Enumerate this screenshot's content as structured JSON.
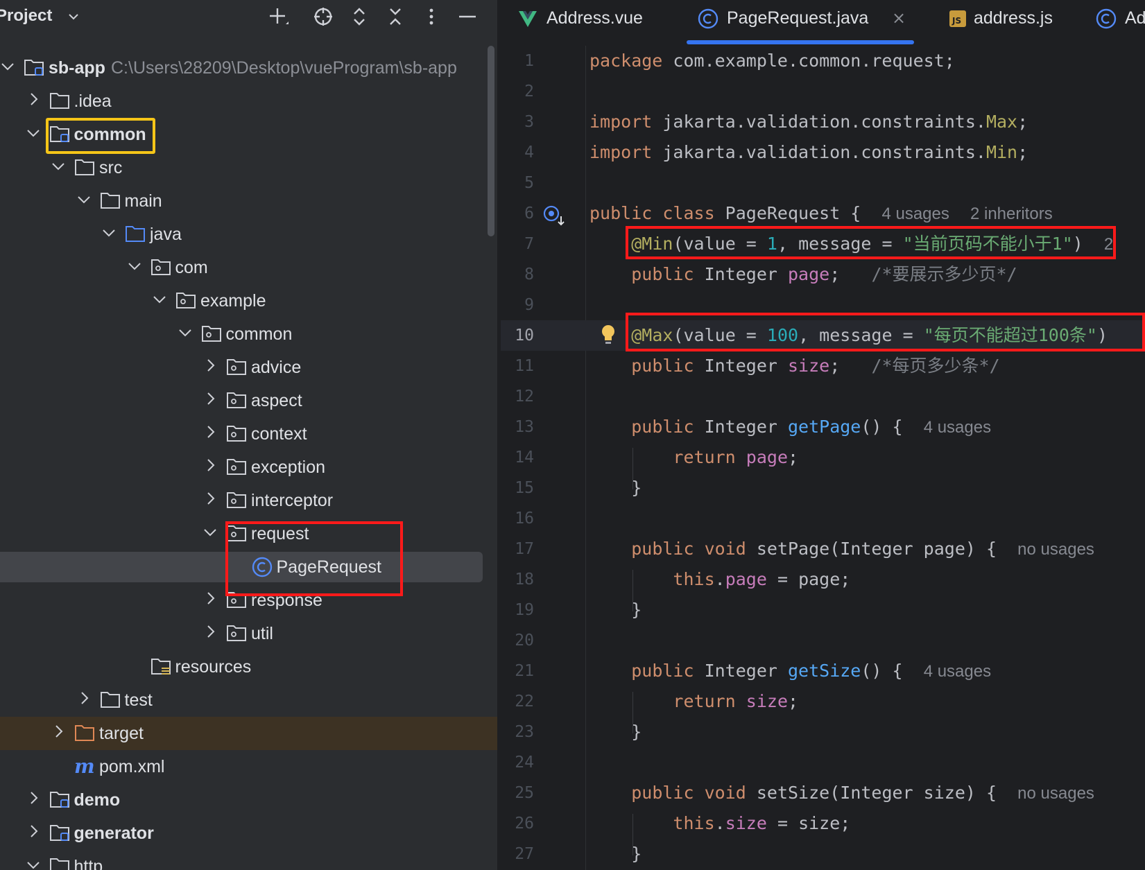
{
  "panel": {
    "title": "Project",
    "title_chevron": "chevron-down-icon",
    "header_icons": [
      "add-icon",
      "locate-icon",
      "expand-collapse-icon",
      "close-all-icon",
      "more-icon",
      "minimize-icon"
    ]
  },
  "tree": [
    {
      "label": "sb-app",
      "path": "C:\\Users\\28209\\Desktop\\vueProgram\\sb-app",
      "icon": "module-folder-icon",
      "chevron": "down",
      "bold": true
    },
    {
      "label": ".idea",
      "icon": "folder-icon",
      "chevron": "right"
    },
    {
      "label": "common",
      "icon": "module-folder-icon",
      "chevron": "down",
      "bold": true
    },
    {
      "label": "src",
      "icon": "folder-icon",
      "chevron": "down"
    },
    {
      "label": "main",
      "icon": "folder-icon",
      "chevron": "down"
    },
    {
      "label": "java",
      "icon": "source-folder-icon",
      "chevron": "down"
    },
    {
      "label": "com",
      "icon": "package-icon",
      "chevron": "down"
    },
    {
      "label": "example",
      "icon": "package-icon",
      "chevron": "down"
    },
    {
      "label": "common",
      "icon": "package-icon",
      "chevron": "down"
    },
    {
      "label": "advice",
      "icon": "package-icon",
      "chevron": "right"
    },
    {
      "label": "aspect",
      "icon": "package-icon",
      "chevron": "right"
    },
    {
      "label": "context",
      "icon": "package-icon",
      "chevron": "right"
    },
    {
      "label": "exception",
      "icon": "package-icon",
      "chevron": "right"
    },
    {
      "label": "interceptor",
      "icon": "package-icon",
      "chevron": "right"
    },
    {
      "label": "request",
      "icon": "package-icon",
      "chevron": "down"
    },
    {
      "label": "PageRequest",
      "icon": "class-icon",
      "chevron": "none"
    },
    {
      "label": "response",
      "icon": "package-icon",
      "chevron": "right"
    },
    {
      "label": "util",
      "icon": "package-icon",
      "chevron": "right"
    },
    {
      "label": "resources",
      "icon": "resources-folder-icon",
      "chevron": "none"
    },
    {
      "label": "test",
      "icon": "folder-icon",
      "chevron": "right"
    },
    {
      "label": "target",
      "icon": "excluded-folder-icon",
      "chevron": "right"
    },
    {
      "label": "pom.xml",
      "icon": "maven-icon",
      "chevron": "none"
    },
    {
      "label": "demo",
      "icon": "module-folder-icon",
      "chevron": "right",
      "bold": true
    },
    {
      "label": "generator",
      "icon": "module-folder-icon",
      "chevron": "right",
      "bold": true
    },
    {
      "label": "http",
      "icon": "folder-icon",
      "chevron": "down"
    }
  ],
  "tabs": [
    {
      "label": "Address.vue",
      "icon": "vue-icon"
    },
    {
      "label": "PageRequest.java",
      "icon": "class-icon",
      "active": true,
      "close": "×"
    },
    {
      "label": "address.js",
      "icon": "js-icon"
    },
    {
      "label": "Ad",
      "icon": "class-icon"
    }
  ],
  "code": {
    "line_numbers": [
      "1",
      "2",
      "3",
      "4",
      "5",
      "6",
      "7",
      "8",
      "9",
      "10",
      "11",
      "12",
      "13",
      "14",
      "15",
      "16",
      "17",
      "18",
      "19",
      "20",
      "21",
      "22",
      "23",
      "24",
      "25",
      "26",
      "27"
    ],
    "current_line": "10",
    "l1": {
      "kw": "package",
      "rest": " com.example.common.request;"
    },
    "l3": {
      "kw": "import",
      "mid": " jakarta.validation.constraints.",
      "ann": "Max",
      "end": ";"
    },
    "l4": {
      "kw": "import",
      "mid": " jakarta.validation.constraints.",
      "ann": "Min",
      "end": ";"
    },
    "l6": {
      "kw": "public class",
      "name": " PageRequest {",
      "hint1": "4 usages",
      "hint2": "2 inheritors"
    },
    "l7": {
      "ann": "@Min",
      "p1": "(value = ",
      "num": "1",
      "p2": ", message = ",
      "str": "\"当前页码不能小于1\"",
      "p3": ")",
      "hint": "2"
    },
    "l8": {
      "kw": "public",
      "type": " Integer ",
      "fld": "page",
      "semi": ";",
      "cmt": "/*要展示多少页*/"
    },
    "l10": {
      "ann": "@Max",
      "p1": "(value = ",
      "num": "100",
      "p2": ", message = ",
      "str": "\"每页不能超过100条\"",
      "p3": ")"
    },
    "l11": {
      "kw": "public",
      "type": " Integer ",
      "fld": "size",
      "semi": ";",
      "cmt": "/*每页多少条*/"
    },
    "l13": {
      "kw": "public",
      "type": " Integer ",
      "mth": "getPage",
      "rest": "() {",
      "hint": "4 usages"
    },
    "l14": {
      "kw": "return",
      "fld": "page",
      "semi": ";"
    },
    "l15": "}",
    "l17": {
      "kw": "public void",
      "mth": " setPage",
      "rest": "(Integer page) {",
      "hint": "no usages"
    },
    "l18": {
      "kw": "this",
      "dot": ".",
      "fld": "page",
      "rest": " = page;"
    },
    "l19": "}",
    "l21": {
      "kw": "public",
      "type": " Integer ",
      "mth": "getSize",
      "rest": "() {",
      "hint": "4 usages"
    },
    "l22": {
      "kw": "return",
      "fld": "size",
      "semi": ";"
    },
    "l23": "}",
    "l25": {
      "kw": "public void",
      "mth": " setSize",
      "rest": "(Integer size) {",
      "hint": "no usages"
    },
    "l26": {
      "kw": "this",
      "dot": ".",
      "fld": "size",
      "rest": " = size;"
    },
    "l27": "}"
  },
  "colors": {
    "background": "#1e1f22",
    "panel": "#2b2d30",
    "keyword": "#cf8e6d",
    "annotation": "#b3ae60",
    "string": "#6aab73",
    "field": "#c77dbb",
    "method": "#56a8f5",
    "highlight_red": "#ff1a1a",
    "highlight_yellow": "#f5c518"
  }
}
